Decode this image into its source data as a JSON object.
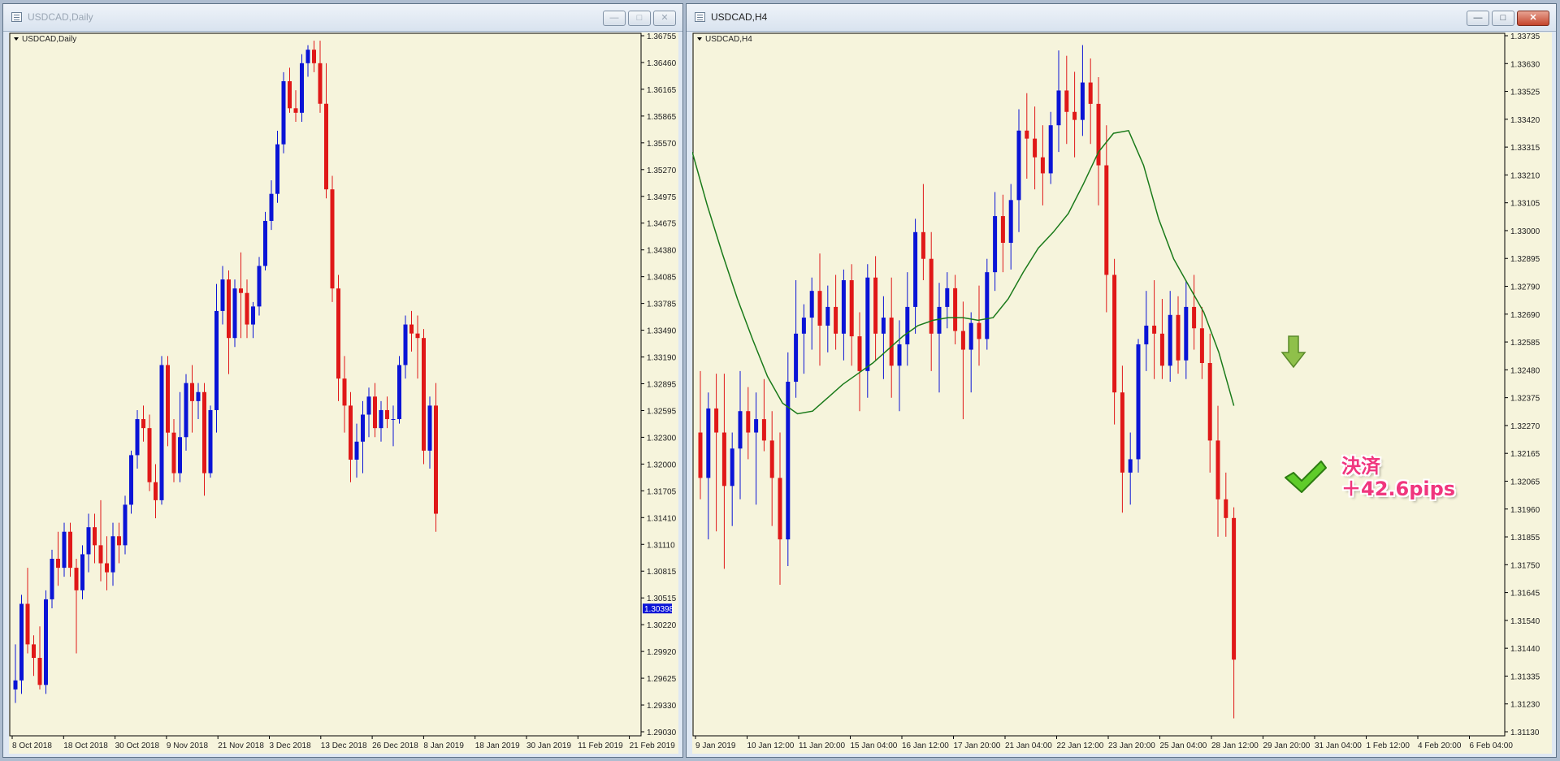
{
  "windows": {
    "left": {
      "title": "USDCAD,Daily",
      "symbol_label": "USDCAD,Daily"
    },
    "right": {
      "title": "USDCAD,H4",
      "symbol_label": "USDCAD,H4"
    }
  },
  "window_controls": {
    "minimize": "—",
    "restore": "□",
    "close": "✕"
  },
  "annotation": {
    "line1": "決済",
    "line2": "＋42.6pips",
    "check_icon": "check-icon",
    "arrow_icon": "down-arrow-icon",
    "check_color": "#5fcc2a",
    "arrow_color": "#8fc04a"
  },
  "colors": {
    "background": "#f6f4dc",
    "bull": "#0a14d6",
    "bear": "#e01818",
    "ma": "#1a7a1a",
    "axis": "#000000",
    "current_price_bg": "#0a14d6"
  },
  "chart_data": [
    {
      "type": "candlestick",
      "symbol": "USDCAD",
      "timeframe": "Daily",
      "title": "USDCAD,Daily",
      "ylim": [
        1.2903,
        1.36755
      ],
      "y_ticks": [
        "1.36755",
        "1.36460",
        "1.36165",
        "1.35865",
        "1.35570",
        "1.35270",
        "1.34975",
        "1.34675",
        "1.34380",
        "1.34085",
        "1.33785",
        "1.33490",
        "1.33190",
        "1.32895",
        "1.32595",
        "1.32300",
        "1.32000",
        "1.31705",
        "1.31410",
        "1.31110",
        "1.30815",
        "1.30515",
        "1.30220",
        "1.29920",
        "1.29625",
        "1.29330",
        "1.29030"
      ],
      "current_price": "1.30398",
      "x_ticks": [
        "8 Oct 2018",
        "18 Oct 2018",
        "30 Oct 2018",
        "9 Nov 2018",
        "21 Nov 2018",
        "3 Dec 2018",
        "13 Dec 2018",
        "26 Dec 2018",
        "8 Jan 2019",
        "18 Jan 2019",
        "30 Jan 2019",
        "11 Feb 2019",
        "21 Feb 2019"
      ],
      "candles": [
        [
          1.295,
          1.3,
          1.2935,
          1.296
        ],
        [
          1.296,
          1.3055,
          1.2945,
          1.3045
        ],
        [
          1.3045,
          1.3085,
          1.299,
          1.3
        ],
        [
          1.3,
          1.301,
          1.2965,
          1.2985
        ],
        [
          1.2985,
          1.302,
          1.295,
          1.2955
        ],
        [
          1.2955,
          1.306,
          1.2945,
          1.305
        ],
        [
          1.305,
          1.3105,
          1.304,
          1.3095
        ],
        [
          1.3095,
          1.3125,
          1.3065,
          1.3085
        ],
        [
          1.3085,
          1.3135,
          1.3075,
          1.3125
        ],
        [
          1.3125,
          1.3135,
          1.3075,
          1.3085
        ],
        [
          1.3085,
          1.3095,
          1.299,
          1.306
        ],
        [
          1.306,
          1.311,
          1.305,
          1.31
        ],
        [
          1.31,
          1.3145,
          1.308,
          1.313
        ],
        [
          1.313,
          1.3145,
          1.309,
          1.311
        ],
        [
          1.311,
          1.316,
          1.307,
          1.309
        ],
        [
          1.309,
          1.312,
          1.306,
          1.308
        ],
        [
          1.308,
          1.3135,
          1.3065,
          1.312
        ],
        [
          1.312,
          1.3135,
          1.309,
          1.311
        ],
        [
          1.311,
          1.3165,
          1.31,
          1.3155
        ],
        [
          1.3155,
          1.3215,
          1.3145,
          1.321
        ],
        [
          1.321,
          1.326,
          1.3195,
          1.325
        ],
        [
          1.325,
          1.3265,
          1.3225,
          1.324
        ],
        [
          1.324,
          1.3255,
          1.317,
          1.318
        ],
        [
          1.318,
          1.32,
          1.314,
          1.316
        ],
        [
          1.316,
          1.332,
          1.3155,
          1.331
        ],
        [
          1.331,
          1.332,
          1.322,
          1.3235
        ],
        [
          1.3235,
          1.325,
          1.318,
          1.319
        ],
        [
          1.319,
          1.328,
          1.318,
          1.323
        ],
        [
          1.323,
          1.33,
          1.3215,
          1.329
        ],
        [
          1.329,
          1.331,
          1.3235,
          1.327
        ],
        [
          1.327,
          1.329,
          1.325,
          1.328
        ],
        [
          1.328,
          1.329,
          1.3165,
          1.319
        ],
        [
          1.319,
          1.3265,
          1.3185,
          1.326
        ],
        [
          1.326,
          1.34,
          1.3235,
          1.337
        ],
        [
          1.337,
          1.342,
          1.3355,
          1.3405
        ],
        [
          1.3405,
          1.3415,
          1.33,
          1.334
        ],
        [
          1.334,
          1.3405,
          1.333,
          1.3395
        ],
        [
          1.3395,
          1.3435,
          1.334,
          1.339
        ],
        [
          1.339,
          1.3405,
          1.334,
          1.3355
        ],
        [
          1.3355,
          1.338,
          1.334,
          1.3375
        ],
        [
          1.3375,
          1.343,
          1.3365,
          1.342
        ],
        [
          1.342,
          1.348,
          1.3415,
          1.347
        ],
        [
          1.347,
          1.3515,
          1.346,
          1.35
        ],
        [
          1.35,
          1.357,
          1.349,
          1.3555
        ],
        [
          1.3555,
          1.3635,
          1.3545,
          1.3625
        ],
        [
          1.3625,
          1.364,
          1.359,
          1.3595
        ],
        [
          1.3595,
          1.3615,
          1.358,
          1.359
        ],
        [
          1.359,
          1.3655,
          1.358,
          1.3645
        ],
        [
          1.3645,
          1.3665,
          1.363,
          1.366
        ],
        [
          1.366,
          1.367,
          1.3635,
          1.3645
        ],
        [
          1.3645,
          1.367,
          1.359,
          1.36
        ],
        [
          1.36,
          1.3645,
          1.3495,
          1.3505
        ],
        [
          1.3505,
          1.352,
          1.338,
          1.3395
        ],
        [
          1.3395,
          1.341,
          1.327,
          1.3295
        ],
        [
          1.3295,
          1.332,
          1.3235,
          1.3265
        ],
        [
          1.3265,
          1.328,
          1.318,
          1.3205
        ],
        [
          1.3205,
          1.3245,
          1.3185,
          1.3225
        ],
        [
          1.3225,
          1.327,
          1.319,
          1.3255
        ],
        [
          1.3255,
          1.3285,
          1.323,
          1.3275
        ],
        [
          1.3275,
          1.329,
          1.323,
          1.324
        ],
        [
          1.324,
          1.327,
          1.3225,
          1.326
        ],
        [
          1.326,
          1.3275,
          1.324,
          1.325
        ],
        [
          1.325,
          1.3265,
          1.322,
          1.325
        ],
        [
          1.325,
          1.332,
          1.3245,
          1.331
        ],
        [
          1.331,
          1.3365,
          1.3295,
          1.3355
        ],
        [
          1.3355,
          1.337,
          1.3325,
          1.3345
        ],
        [
          1.3345,
          1.3365,
          1.3295,
          1.334
        ],
        [
          1.334,
          1.335,
          1.32,
          1.3215
        ],
        [
          1.3215,
          1.3275,
          1.3195,
          1.3265
        ],
        [
          1.3265,
          1.329,
          1.3125,
          1.3145
        ]
      ]
    },
    {
      "type": "candlestick",
      "symbol": "USDCAD",
      "timeframe": "H4",
      "title": "USDCAD,H4",
      "ylim": [
        1.3113,
        1.33735
      ],
      "y_ticks": [
        "1.33735",
        "1.33630",
        "1.33525",
        "1.33420",
        "1.33315",
        "1.33210",
        "1.33105",
        "1.33000",
        "1.32895",
        "1.32790",
        "1.32690",
        "1.32585",
        "1.32480",
        "1.32375",
        "1.32270",
        "1.32165",
        "1.32065",
        "1.31960",
        "1.31855",
        "1.31750",
        "1.31645",
        "1.31540",
        "1.31440",
        "1.31335",
        "1.31230",
        "1.31130"
      ],
      "x_ticks": [
        "9 Jan 2019",
        "10 Jan 12:00",
        "11 Jan 20:00",
        "15 Jan 04:00",
        "16 Jan 12:00",
        "17 Jan 20:00",
        "21 Jan 04:00",
        "22 Jan 12:00",
        "23 Jan 20:00",
        "25 Jan 04:00",
        "28 Jan 12:00",
        "29 Jan 20:00",
        "31 Jan 04:00",
        "1 Feb 12:00",
        "4 Feb 20:00",
        "6 Feb 04:00"
      ],
      "candles": [
        [
          1.3225,
          1.3248,
          1.32,
          1.3208
        ],
        [
          1.3208,
          1.324,
          1.3185,
          1.3234
        ],
        [
          1.3234,
          1.3247,
          1.3188,
          1.3225
        ],
        [
          1.3225,
          1.3247,
          1.3174,
          1.3205
        ],
        [
          1.3205,
          1.3225,
          1.319,
          1.3219
        ],
        [
          1.3219,
          1.3248,
          1.32,
          1.3233
        ],
        [
          1.3233,
          1.3242,
          1.3215,
          1.3225
        ],
        [
          1.3225,
          1.324,
          1.3198,
          1.323
        ],
        [
          1.323,
          1.3245,
          1.3218,
          1.3222
        ],
        [
          1.3222,
          1.3233,
          1.319,
          1.3208
        ],
        [
          1.3208,
          1.3225,
          1.3168,
          1.3185
        ],
        [
          1.3185,
          1.3255,
          1.3175,
          1.3244
        ],
        [
          1.3244,
          1.3282,
          1.3238,
          1.3262
        ],
        [
          1.3262,
          1.3273,
          1.3247,
          1.3268
        ],
        [
          1.3268,
          1.3283,
          1.3256,
          1.3278
        ],
        [
          1.3278,
          1.3292,
          1.325,
          1.3265
        ],
        [
          1.3265,
          1.328,
          1.3255,
          1.3272
        ],
        [
          1.3272,
          1.3284,
          1.3256,
          1.3262
        ],
        [
          1.3262,
          1.3286,
          1.3252,
          1.3282
        ],
        [
          1.3282,
          1.3288,
          1.325,
          1.3261
        ],
        [
          1.3261,
          1.327,
          1.3233,
          1.3248
        ],
        [
          1.3248,
          1.3288,
          1.3238,
          1.3283
        ],
        [
          1.3283,
          1.3291,
          1.3252,
          1.3262
        ],
        [
          1.3262,
          1.3276,
          1.3245,
          1.3268
        ],
        [
          1.3268,
          1.3283,
          1.3238,
          1.325
        ],
        [
          1.325,
          1.3267,
          1.3233,
          1.3258
        ],
        [
          1.3258,
          1.3285,
          1.325,
          1.3272
        ],
        [
          1.3272,
          1.3305,
          1.3262,
          1.33
        ],
        [
          1.33,
          1.3318,
          1.3282,
          1.329
        ],
        [
          1.329,
          1.33,
          1.3248,
          1.3262
        ],
        [
          1.3262,
          1.3281,
          1.324,
          1.3272
        ],
        [
          1.3272,
          1.3285,
          1.3264,
          1.3279
        ],
        [
          1.3279,
          1.3284,
          1.3258,
          1.3263
        ],
        [
          1.3263,
          1.3274,
          1.323,
          1.3256
        ],
        [
          1.3256,
          1.327,
          1.324,
          1.3266
        ],
        [
          1.3266,
          1.328,
          1.325,
          1.326
        ],
        [
          1.326,
          1.329,
          1.3256,
          1.3285
        ],
        [
          1.3285,
          1.3315,
          1.3278,
          1.3306
        ],
        [
          1.3306,
          1.3314,
          1.3285,
          1.3296
        ],
        [
          1.3296,
          1.3318,
          1.3286,
          1.3312
        ],
        [
          1.3312,
          1.3346,
          1.33,
          1.3338
        ],
        [
          1.3338,
          1.3352,
          1.332,
          1.3335
        ],
        [
          1.3335,
          1.3347,
          1.3316,
          1.3328
        ],
        [
          1.3328,
          1.334,
          1.331,
          1.3322
        ],
        [
          1.3322,
          1.3345,
          1.3318,
          1.334
        ],
        [
          1.334,
          1.3368,
          1.333,
          1.3353
        ],
        [
          1.3353,
          1.3366,
          1.3333,
          1.3345
        ],
        [
          1.3345,
          1.336,
          1.3328,
          1.3342
        ],
        [
          1.3342,
          1.337,
          1.3336,
          1.3356
        ],
        [
          1.3356,
          1.3365,
          1.3333,
          1.3348
        ],
        [
          1.3348,
          1.3358,
          1.331,
          1.3325
        ],
        [
          1.3325,
          1.334,
          1.327,
          1.3284
        ],
        [
          1.3284,
          1.329,
          1.3228,
          1.324
        ],
        [
          1.324,
          1.325,
          1.3195,
          1.321
        ],
        [
          1.321,
          1.3225,
          1.3198,
          1.3215
        ],
        [
          1.3215,
          1.326,
          1.321,
          1.3258
        ],
        [
          1.3258,
          1.3278,
          1.3248,
          1.3265
        ],
        [
          1.3265,
          1.3282,
          1.3245,
          1.3262
        ],
        [
          1.3262,
          1.3275,
          1.3245,
          1.325
        ],
        [
          1.325,
          1.3278,
          1.3244,
          1.3269
        ],
        [
          1.3269,
          1.3276,
          1.3247,
          1.3252
        ],
        [
          1.3252,
          1.3282,
          1.3245,
          1.3272
        ],
        [
          1.3272,
          1.3284,
          1.3256,
          1.3264
        ],
        [
          1.3264,
          1.3272,
          1.3245,
          1.3251
        ],
        [
          1.3251,
          1.3262,
          1.321,
          1.3222
        ],
        [
          1.3222,
          1.3235,
          1.3186,
          1.32
        ],
        [
          1.32,
          1.321,
          1.3186,
          1.3193
        ],
        [
          1.3193,
          1.3197,
          1.3118,
          1.314
        ]
      ],
      "moving_average": [
        1.333,
        1.331,
        1.3292,
        1.3275,
        1.326,
        1.3246,
        1.3236,
        1.3232,
        1.3233,
        1.3238,
        1.3243,
        1.3247,
        1.3251,
        1.3256,
        1.3261,
        1.3265,
        1.3267,
        1.3268,
        1.3268,
        1.3267,
        1.3268,
        1.3275,
        1.3285,
        1.3294,
        1.33,
        1.3307,
        1.3318,
        1.333,
        1.3337,
        1.3338,
        1.3325,
        1.3305,
        1.329,
        1.328,
        1.327,
        1.3255,
        1.3235
      ],
      "annotation_text": [
        "決済",
        "＋42.6pips"
      ]
    }
  ]
}
